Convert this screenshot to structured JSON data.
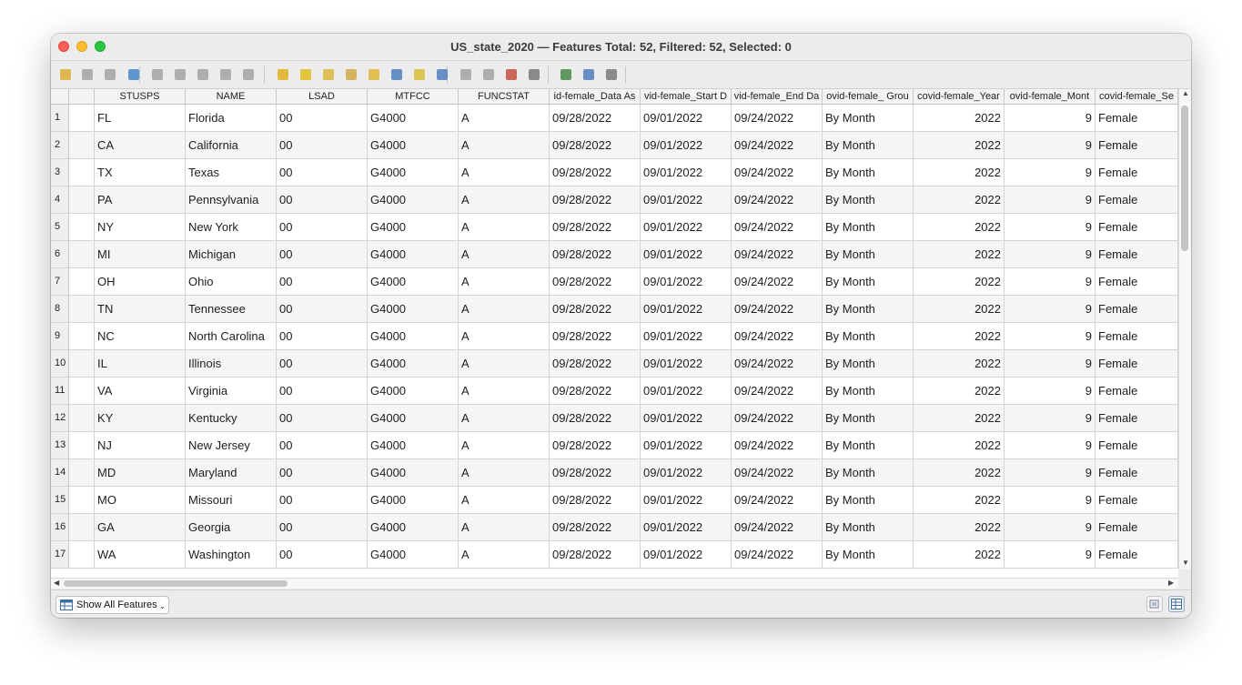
{
  "window": {
    "title": "US_state_2020 — Features Total: 52, Filtered: 52, Selected: 0"
  },
  "toolbar": {
    "buttons": [
      "toggle-editing-icon",
      "multi-edit-icon",
      "save-edits-icon",
      "reload-icon",
      "add-feature-icon",
      "delete-selected-icon",
      "cut-icon",
      "copy-icon",
      "paste-icon",
      "expression-select-icon",
      "select-all-icon",
      "invert-selection-icon",
      "deselect-all-icon",
      "filter-selection-icon",
      "move-selection-top-icon",
      "pan-to-selection-icon",
      "zoom-to-selection-icon",
      "new-field-icon",
      "delete-field-icon",
      "field-calculator-icon",
      "conditional-format-icon",
      "dock-table-icon",
      "actions-icon",
      "form-view-icon"
    ]
  },
  "table": {
    "columns": [
      "",
      "STUSPS",
      "NAME",
      "LSAD",
      "MTFCC",
      "FUNCSTAT",
      "id-female_Data As",
      "vid-female_Start D",
      "vid-female_End Da",
      "ovid-female_ Grou",
      "covid-female_Year",
      "ovid-female_Mont",
      "covid-female_Se"
    ],
    "rows": [
      {
        "n": "1",
        "c": [
          "",
          "FL",
          "Florida",
          "00",
          "G4000",
          "A",
          "09/28/2022",
          "09/01/2022",
          "09/24/2022",
          "By Month",
          "2022",
          "9",
          "Female"
        ]
      },
      {
        "n": "2",
        "c": [
          "",
          "CA",
          "California",
          "00",
          "G4000",
          "A",
          "09/28/2022",
          "09/01/2022",
          "09/24/2022",
          "By Month",
          "2022",
          "9",
          "Female"
        ]
      },
      {
        "n": "3",
        "c": [
          "",
          "TX",
          "Texas",
          "00",
          "G4000",
          "A",
          "09/28/2022",
          "09/01/2022",
          "09/24/2022",
          "By Month",
          "2022",
          "9",
          "Female"
        ]
      },
      {
        "n": "4",
        "c": [
          "",
          "PA",
          "Pennsylvania",
          "00",
          "G4000",
          "A",
          "09/28/2022",
          "09/01/2022",
          "09/24/2022",
          "By Month",
          "2022",
          "9",
          "Female"
        ]
      },
      {
        "n": "5",
        "c": [
          "",
          "NY",
          "New York",
          "00",
          "G4000",
          "A",
          "09/28/2022",
          "09/01/2022",
          "09/24/2022",
          "By Month",
          "2022",
          "9",
          "Female"
        ]
      },
      {
        "n": "6",
        "c": [
          "",
          "MI",
          "Michigan",
          "00",
          "G4000",
          "A",
          "09/28/2022",
          "09/01/2022",
          "09/24/2022",
          "By Month",
          "2022",
          "9",
          "Female"
        ]
      },
      {
        "n": "7",
        "c": [
          "",
          "OH",
          "Ohio",
          "00",
          "G4000",
          "A",
          "09/28/2022",
          "09/01/2022",
          "09/24/2022",
          "By Month",
          "2022",
          "9",
          "Female"
        ]
      },
      {
        "n": "8",
        "c": [
          "",
          "TN",
          "Tennessee",
          "00",
          "G4000",
          "A",
          "09/28/2022",
          "09/01/2022",
          "09/24/2022",
          "By Month",
          "2022",
          "9",
          "Female"
        ]
      },
      {
        "n": "9",
        "c": [
          "",
          "NC",
          "North Carolina",
          "00",
          "G4000",
          "A",
          "09/28/2022",
          "09/01/2022",
          "09/24/2022",
          "By Month",
          "2022",
          "9",
          "Female"
        ]
      },
      {
        "n": "10",
        "c": [
          "",
          "IL",
          "Illinois",
          "00",
          "G4000",
          "A",
          "09/28/2022",
          "09/01/2022",
          "09/24/2022",
          "By Month",
          "2022",
          "9",
          "Female"
        ]
      },
      {
        "n": "11",
        "c": [
          "",
          "VA",
          "Virginia",
          "00",
          "G4000",
          "A",
          "09/28/2022",
          "09/01/2022",
          "09/24/2022",
          "By Month",
          "2022",
          "9",
          "Female"
        ]
      },
      {
        "n": "12",
        "c": [
          "",
          "KY",
          "Kentucky",
          "00",
          "G4000",
          "A",
          "09/28/2022",
          "09/01/2022",
          "09/24/2022",
          "By Month",
          "2022",
          "9",
          "Female"
        ]
      },
      {
        "n": "13",
        "c": [
          "",
          "NJ",
          "New Jersey",
          "00",
          "G4000",
          "A",
          "09/28/2022",
          "09/01/2022",
          "09/24/2022",
          "By Month",
          "2022",
          "9",
          "Female"
        ]
      },
      {
        "n": "14",
        "c": [
          "",
          "MD",
          "Maryland",
          "00",
          "G4000",
          "A",
          "09/28/2022",
          "09/01/2022",
          "09/24/2022",
          "By Month",
          "2022",
          "9",
          "Female"
        ]
      },
      {
        "n": "15",
        "c": [
          "",
          "MO",
          "Missouri",
          "00",
          "G4000",
          "A",
          "09/28/2022",
          "09/01/2022",
          "09/24/2022",
          "By Month",
          "2022",
          "9",
          "Female"
        ]
      },
      {
        "n": "16",
        "c": [
          "",
          "GA",
          "Georgia",
          "00",
          "G4000",
          "A",
          "09/28/2022",
          "09/01/2022",
          "09/24/2022",
          "By Month",
          "2022",
          "9",
          "Female"
        ]
      },
      {
        "n": "17",
        "c": [
          "",
          "WA",
          "Washington",
          "00",
          "G4000",
          "A",
          "09/28/2022",
          "09/01/2022",
          "09/24/2022",
          "By Month",
          "2022",
          "9",
          "Female"
        ]
      }
    ]
  },
  "statusbar": {
    "show_features_label": "Show All Features"
  }
}
